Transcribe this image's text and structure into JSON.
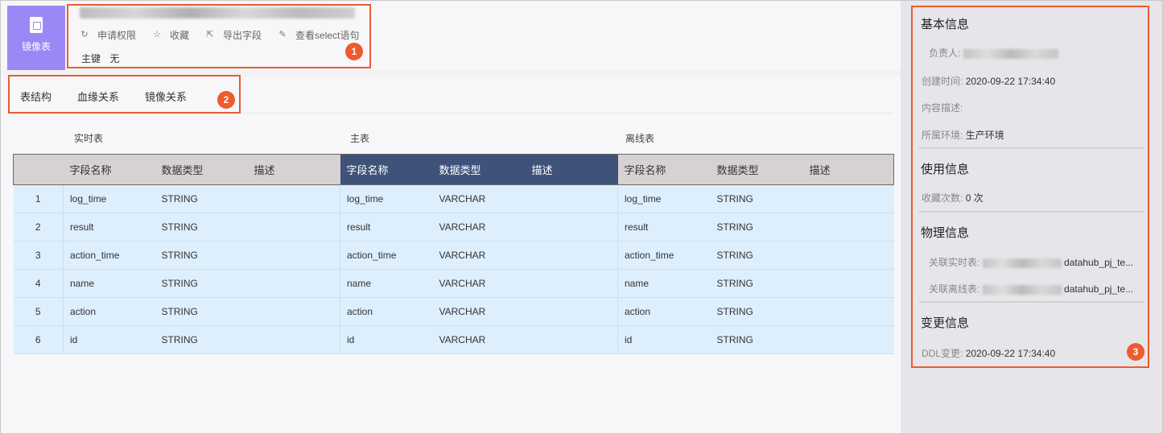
{
  "header": {
    "badge_label": "镜像表",
    "actions": [
      {
        "icon": "apply-permission-icon",
        "glyph": "↻",
        "label": "申请权限"
      },
      {
        "icon": "star-icon",
        "glyph": "☆",
        "label": "收藏"
      },
      {
        "icon": "export-icon",
        "glyph": "⇱",
        "label": "导出字段"
      },
      {
        "icon": "edit-icon",
        "glyph": "✎",
        "label": "查看select语句"
      }
    ],
    "primary_key_label": "主键",
    "primary_key_value": "无"
  },
  "markers": [
    "1",
    "2",
    "3"
  ],
  "tabs": [
    {
      "label": "表结构"
    },
    {
      "label": "血缘关系"
    },
    {
      "label": "镜像关系"
    }
  ],
  "groups": {
    "realtime": "实时表",
    "main": "主表",
    "offline": "离线表"
  },
  "columns": {
    "field_name": "字段名称",
    "data_type": "数据类型",
    "description": "描述"
  },
  "rows": [
    {
      "num": "1",
      "rt_name": "log_time",
      "rt_type": "STRING",
      "m_name": "log_time",
      "m_type": "VARCHAR",
      "off_name": "log_time",
      "off_type": "STRING"
    },
    {
      "num": "2",
      "rt_name": "result",
      "rt_type": "STRING",
      "m_name": "result",
      "m_type": "VARCHAR",
      "off_name": "result",
      "off_type": "STRING"
    },
    {
      "num": "3",
      "rt_name": "action_time",
      "rt_type": "STRING",
      "m_name": "action_time",
      "m_type": "VARCHAR",
      "off_name": "action_time",
      "off_type": "STRING"
    },
    {
      "num": "4",
      "rt_name": "name",
      "rt_type": "STRING",
      "m_name": "name",
      "m_type": "VARCHAR",
      "off_name": "name",
      "off_type": "STRING"
    },
    {
      "num": "5",
      "rt_name": "action",
      "rt_type": "STRING",
      "m_name": "action",
      "m_type": "VARCHAR",
      "off_name": "action",
      "off_type": "STRING"
    },
    {
      "num": "6",
      "rt_name": "id",
      "rt_type": "STRING",
      "m_name": "id",
      "m_type": "VARCHAR",
      "off_name": "id",
      "off_type": "STRING"
    }
  ],
  "sidebar": {
    "basic_title": "基本信息",
    "owner_label": "负责人:",
    "created_label": "创建时间:",
    "created_value": "2020-09-22 17:34:40",
    "desc_label": "内容描述:",
    "env_label": "所属环境:",
    "env_value": "生产环境",
    "usage_title": "使用信息",
    "fav_label": "收藏次数:",
    "fav_value": "0 次",
    "physical_title": "物理信息",
    "rt_table_label": "关联实时表:",
    "rt_table_value": "datahub_pj_te...",
    "off_table_label": "关联离线表:",
    "off_table_value": "datahub_pj_te...",
    "change_title": "变更信息",
    "ddl_label": "DDL变更:",
    "ddl_value": "2020-09-22 17:34:40"
  },
  "colors": {
    "badge": "#9b87f5",
    "main_header": "#3f527a",
    "side_header": "#d8d1d1",
    "row_bg": "#ddeefc",
    "annotation": "#ec5a32"
  }
}
